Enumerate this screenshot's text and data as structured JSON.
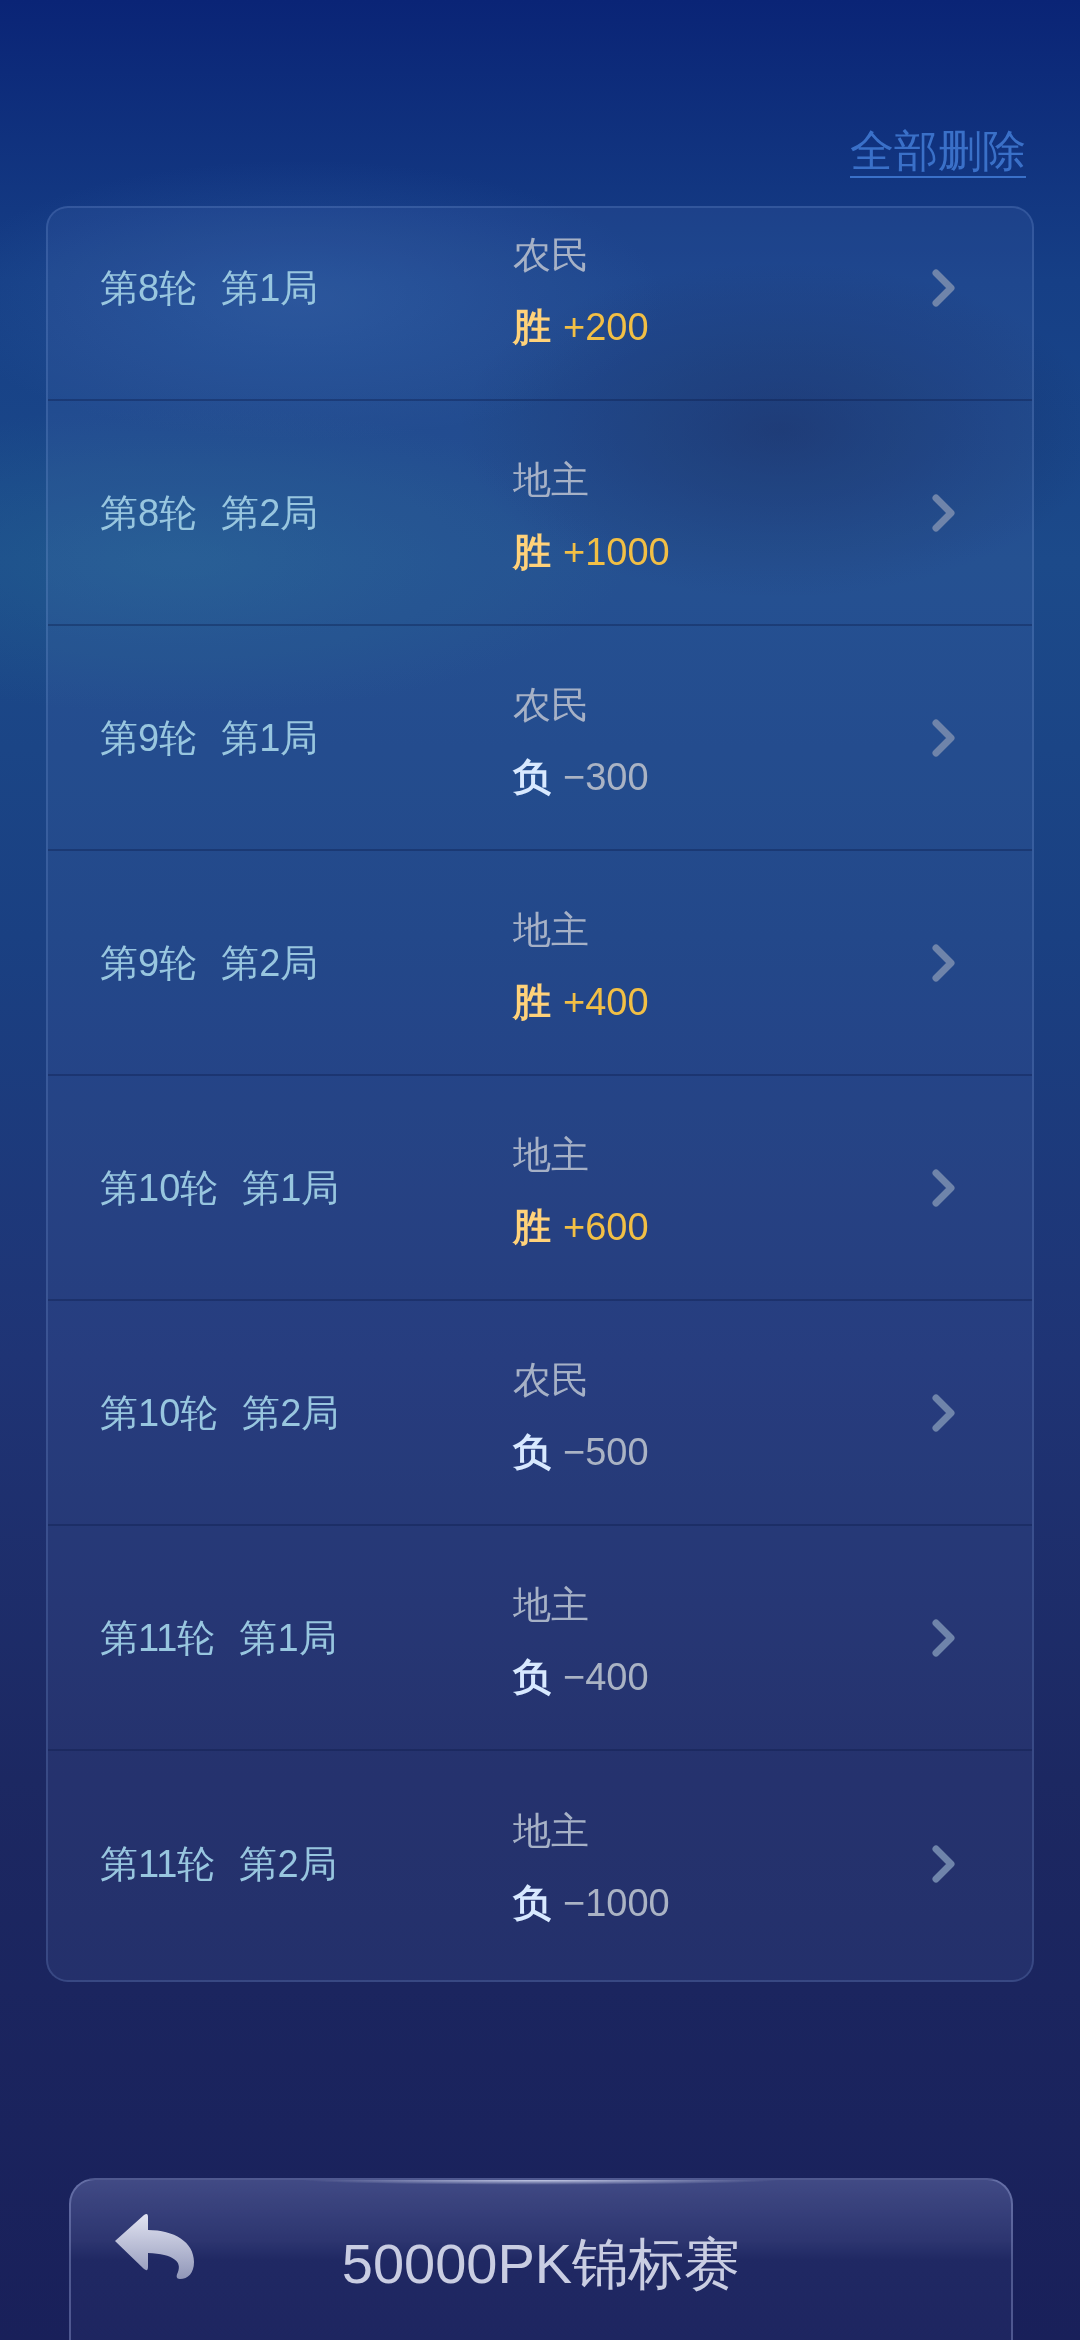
{
  "actions": {
    "delete_all": "全部删除"
  },
  "records": [
    {
      "round": "第8轮",
      "game": "第1局",
      "role": "农民",
      "kind": "win",
      "result": "胜",
      "score": "+200"
    },
    {
      "round": "第8轮",
      "game": "第2局",
      "role": "地主",
      "kind": "win",
      "result": "胜",
      "score": "+1000"
    },
    {
      "round": "第9轮",
      "game": "第1局",
      "role": "农民",
      "kind": "loss",
      "result": "负",
      "score": "−300"
    },
    {
      "round": "第9轮",
      "game": "第2局",
      "role": "地主",
      "kind": "win",
      "result": "胜",
      "score": "+400"
    },
    {
      "round": "第10轮",
      "game": "第1局",
      "role": "地主",
      "kind": "win",
      "result": "胜",
      "score": "+600"
    },
    {
      "round": "第10轮",
      "game": "第2局",
      "role": "农民",
      "kind": "loss",
      "result": "负",
      "score": "−500"
    },
    {
      "round": "第11轮",
      "game": "第1局",
      "role": "地主",
      "kind": "loss",
      "result": "负",
      "score": "−400"
    },
    {
      "round": "第11轮",
      "game": "第2局",
      "role": "地主",
      "kind": "loss",
      "result": "负",
      "score": "−1000"
    }
  ],
  "title_bar": {
    "title": "50000PK锦标赛"
  }
}
